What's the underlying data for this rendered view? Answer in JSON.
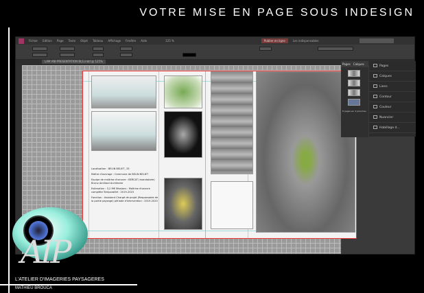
{
  "banner": {
    "title": "VOTRE MISE EN PAGE SOUS INDESIGN"
  },
  "app": {
    "menu": [
      "Fichier",
      "Edition",
      "Page",
      "Texte",
      "Objet",
      "Tableau",
      "Affichage",
      "Fenêtre",
      "Aide"
    ],
    "zoom": "125 %",
    "workspace": "Les indispensables",
    "essentials": "Publier en ligne",
    "document_tab": "LAM ANI PRESENTATION BLS.indd @ 125%"
  },
  "document": {
    "info": [
      "Localisation : BELIN BELIET, 33",
      "Maître d'ouvrage : Commune de BELIN BELIET",
      "Equipe de maîtrise d'oeuvre : BERCAT (mandataire) Bruno Amiliard Architecte",
      "Estimation : 3,2 M€ Missions : Maîtrise d'oeuvre complète Temporalité : 2019-2023",
      "Fonction : Assistant Chargé de projet (Responsable de la partie paysage) période d'intervention : 2019-2020"
    ]
  },
  "pages_panel": {
    "tabs": [
      "Pages",
      "Calques",
      "Liens"
    ],
    "status": "8 pages sur 4 planches"
  },
  "side_panel": {
    "items": [
      "Pages",
      "Calques",
      "Liens",
      "Contour",
      "Couleur",
      "Nuancier",
      "Habillage d..."
    ]
  },
  "brand": {
    "line1": "L'ATELIER D'IMAGERIES PAYSAGERES",
    "line2": "MATHIEU BROUCA",
    "logo_text": "AIP"
  }
}
